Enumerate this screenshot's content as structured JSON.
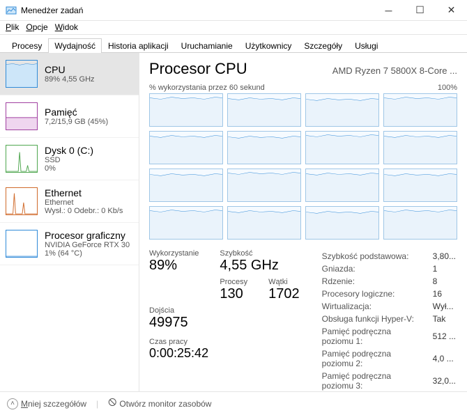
{
  "window": {
    "title": "Menedżer zadań"
  },
  "menu": {
    "file": "Plik",
    "options": "Opcje",
    "view": "Widok"
  },
  "tabs": {
    "items": [
      "Procesy",
      "Wydajność",
      "Historia aplikacji",
      "Uruchamianie",
      "Użytkownicy",
      "Szczegóły",
      "Usługi"
    ],
    "active": 1
  },
  "sidebar": {
    "cpu": {
      "title": "CPU",
      "sub": "89%  4,55 GHz",
      "color": "#2f8ad8"
    },
    "memory": {
      "title": "Pamięć",
      "sub": "7,2/15,9 GB (45%)",
      "color": "#a040a0"
    },
    "disk": {
      "title": "Dysk 0 (C:)",
      "sub1": "SSD",
      "sub2": "0%",
      "color": "#4fa64f"
    },
    "net": {
      "title": "Ethernet",
      "sub1": "Ethernet",
      "sub2": "Wysł.: 0  Odebr.:  0 Kb/s",
      "color": "#d06a2a"
    },
    "gpu": {
      "title": "Procesor graficzny",
      "sub1": "NVIDIA GeForce RTX 30",
      "sub2": "1%  (64 °C)",
      "color": "#2f8ad8"
    }
  },
  "main": {
    "heading": "Procesor CPU",
    "model": "AMD Ryzen 7 5800X 8-Core ...",
    "graph_label_left": "% wykorzystania przez 60 sekund",
    "graph_label_right": "100%",
    "stats": {
      "util_label": "Wykorzystanie",
      "util": "89%",
      "speed_label": "Szybkość",
      "speed": "4,55 GHz",
      "proc_label": "Procesy",
      "proc": "130",
      "threads_label": "Wątki",
      "threads": "1702",
      "handles_label": "Dojścia",
      "handles": "49975",
      "uptime_label": "Czas pracy",
      "uptime": "0:00:25:42"
    },
    "details": {
      "base_label": "Szybkość podstawowa:",
      "base": "3,80...",
      "sockets_label": "Gniazda:",
      "sockets": "1",
      "cores_label": "Rdzenie:",
      "cores": "8",
      "logical_label": "Procesory logiczne:",
      "logical": "16",
      "virt_label": "Wirtualizacja:",
      "virt": "Wył...",
      "hyperv_label": "Obsługa funkcji Hyper-V:",
      "hyperv": "Tak",
      "l1_label": "Pamięć podręczna poziomu 1:",
      "l1": "512 ...",
      "l2_label": "Pamięć podręczna poziomu 2:",
      "l2": "4,0 ...",
      "l3_label": "Pamięć podręczna poziomu 3:",
      "l3": "32,0..."
    }
  },
  "footer": {
    "less": "Mniej szczegółów",
    "monitor": "Otwórz monitor zasobów"
  },
  "chart_data": {
    "type": "line",
    "title": "% wykorzystania przez 60 sekund",
    "ylim": [
      0,
      100
    ],
    "xlabel": "60 sekund",
    "ylabel": "% wykorzystania",
    "series_count": 16,
    "note": "16 logical-processor mini-graphs; each line hovers ~85–95% utilization across the 60s window",
    "approx_values_per_core": [
      90,
      88,
      91,
      87,
      89,
      92,
      86,
      90,
      88,
      91,
      87,
      93,
      89,
      90,
      88,
      91
    ]
  }
}
